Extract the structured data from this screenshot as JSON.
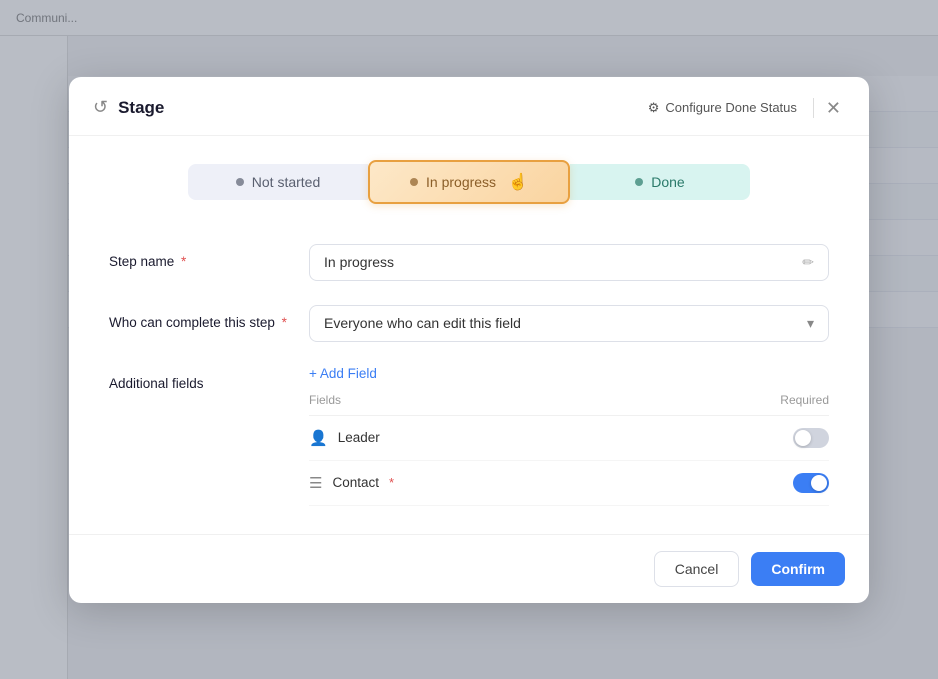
{
  "modal": {
    "title": "Stage",
    "configure_btn_label": "Configure Done Status",
    "close_label": "×"
  },
  "tabs": [
    {
      "id": "not-started",
      "label": "Not started",
      "state": "inactive"
    },
    {
      "id": "in-progress",
      "label": "In progress",
      "state": "active"
    },
    {
      "id": "done",
      "label": "Done",
      "state": "inactive"
    }
  ],
  "form": {
    "step_name_label": "Step name",
    "step_name_required": "*",
    "step_name_value": "In progress",
    "who_label": "Who can complete this step",
    "who_required": "*",
    "who_value": "Everyone who can edit this field",
    "additional_fields_label": "Additional fields",
    "add_field_label": "+ Add Field",
    "fields_col_label": "Fields",
    "required_col_label": "Required",
    "fields": [
      {
        "id": "leader",
        "icon": "person",
        "label": "Leader",
        "required": false,
        "required_star": false,
        "toggle": "off"
      },
      {
        "id": "contact",
        "icon": "list",
        "label": "Contact",
        "required": true,
        "required_star": true,
        "toggle": "on"
      }
    ]
  },
  "footer": {
    "cancel_label": "Cancel",
    "confirm_label": "Confirm"
  },
  "icons": {
    "stage": "↺",
    "gear": "⚙",
    "close": "✕",
    "chevron_down": "▾",
    "pencil": "✏",
    "person": "👤",
    "list": "≡",
    "plus": "+"
  }
}
